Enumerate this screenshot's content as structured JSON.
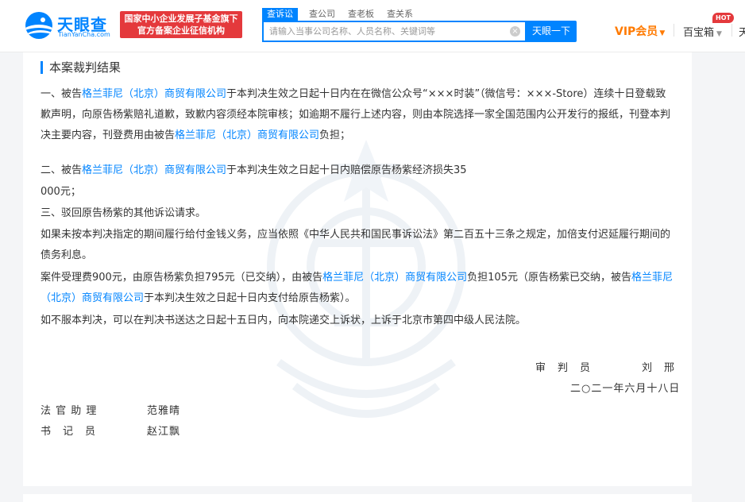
{
  "header": {
    "logo_name": "天眼查",
    "logo_url": "TianYanCha.com",
    "badge_line1": "国家中小企业发展子基金旗下",
    "badge_line2": "官方备案企业征信机构",
    "search_tabs": [
      "查诉讼",
      "查公司",
      "查老板",
      "查关系"
    ],
    "search_placeholder": "请输入当事公司名称、人员名称、关键词等",
    "search_button": "天眼一下",
    "vip_label": "VIP会员",
    "baibaoxiang": "百宝箱",
    "hot_label": "HOT",
    "more_label": "天"
  },
  "colors": {
    "brand_blue": "#0084ff",
    "badge_red": "#e4393c",
    "vip_orange": "#ff7a00"
  },
  "document": {
    "section_title": "本案裁判结果",
    "company": "格兰菲尼（北京）商贸有限公司",
    "p1_a": "一、被告",
    "p1_b": "于本判决生效之日起十日内在在微信公众号“×××时装”（微信号：×××-Store）连续十日登载致歉声明，向原告杨紫赔礼道歉，致歉内容须经本院审核；如逾期不履行上述内容，则由本院选择一家全国范围内公开发行的报纸，刊登本判决主要内容，刊登费用由被告",
    "p1_c": "负担；",
    "p2_a": "二、被告",
    "p2_b": "于本判决生效之日起十日内赔偿原告杨紫经济损失35",
    "p2_c": "000元；",
    "p3": "三、驳回原告杨紫的其他诉讼请求。",
    "p4": "如果未按本判决指定的期间履行给付金钱义务，应当依照《中华人民共和国民事诉讼法》第二百五十三条之规定，加倍支付迟延履行期间的债务利息。",
    "p5_a": "案件受理费900元，由原告杨紫负担795元（已交纳），由被告",
    "p5_b": "负担105元（原告杨紫已交纳，被告",
    "p5_c": "于本判决生效之日起十日内支付给原告杨紫）。",
    "p6": "如不服本判决，可以在判决书送达之日起十五日内，向本院递交上诉状，上诉于北京市第四中级人民法院。",
    "judge_title": "审　判　员",
    "judge_name": "刘　邢",
    "date": "二○二一年六月十八日",
    "assistant_title": "法 官 助 理",
    "assistant_name": "范雅晴",
    "clerk_title": "书　记　员",
    "clerk_name": "赵江飘"
  }
}
